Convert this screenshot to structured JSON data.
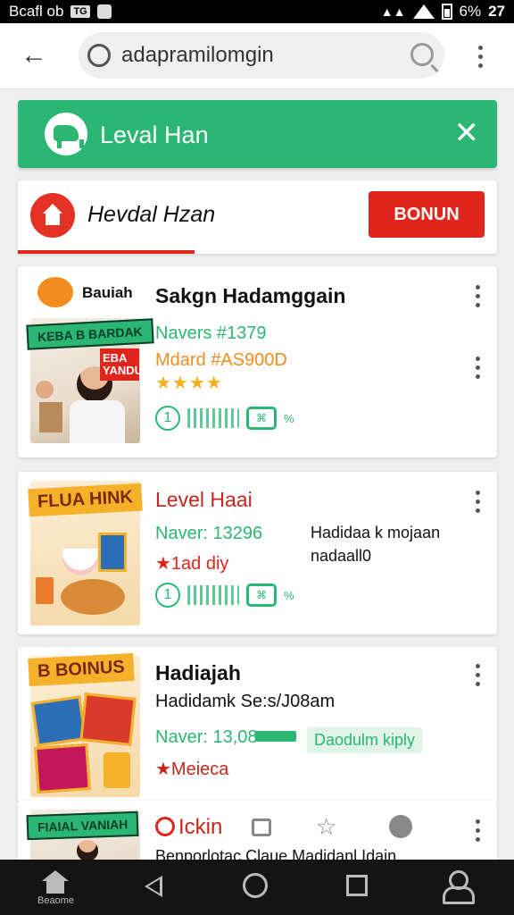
{
  "status_bar": {
    "left_text": "Bcafl ob",
    "badge": "TG",
    "right_text": "6%",
    "clock": "27"
  },
  "address_bar": {
    "url": "adapramilomgin"
  },
  "banner": {
    "title": "Leval Han"
  },
  "header_card": {
    "title": "Hevdal Hzan",
    "button_label": "BONUN"
  },
  "cards": [
    {
      "brand": "Bauiah",
      "ribbon": "KEBA B BARDAK",
      "ribbon_side": "EBA YANDU",
      "title": "Sakgn Hadamggain",
      "line1": "Navers #1379",
      "line2": "Mdard #AS900D",
      "stars": "★★★★",
      "tag_num": "1",
      "tag_text": "%"
    },
    {
      "ribbon": "FLUA HINK",
      "title": "Level Haai",
      "line1": "Naver: 13296",
      "line2": "★1ad diy",
      "side_text_1": "Hadidaa k mojaan",
      "side_text_2": "nadaall0",
      "tag_num": "1",
      "tag_text": "%"
    },
    {
      "ribbon": "B BOINUS",
      "title": "Hadiajah",
      "subtitle": "Hadidamk Se:s/J08am",
      "line1": "Naver: 13,08",
      "chip": "Daodulm kiply",
      "line2": "★Meieca"
    },
    {
      "ribbon": "FIAIAL VANIAH",
      "title": "Ickin",
      "subtitle": "Benporlotac Claue  Madidanl Idain"
    }
  ],
  "navbar": {
    "home_label": "Beaome"
  },
  "colors": {
    "green": "#2bb673",
    "red": "#e0251c",
    "orange": "#f28c1e",
    "star": "#f2b01e"
  }
}
